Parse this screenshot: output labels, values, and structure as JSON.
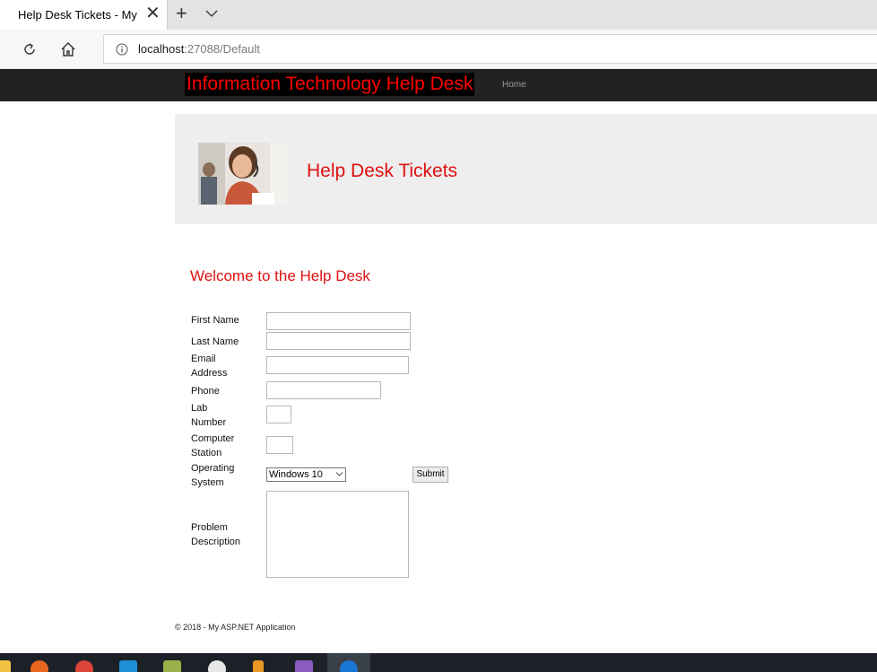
{
  "browser": {
    "tab_title": "Help Desk Tickets - My",
    "close_glyph": "✕",
    "new_tab_glyph": "+",
    "url_host": "localhost",
    "url_rest": ":27088/Default"
  },
  "site": {
    "brand": "Information Technology Help Desk",
    "nav_items": [
      "Home"
    ]
  },
  "jumbotron": {
    "title": "Help Desk Tickets"
  },
  "main": {
    "heading": "Welcome to the Help Desk"
  },
  "form": {
    "labels": {
      "first_name": "First Name",
      "last_name": "Last Name",
      "email": "Email Address",
      "phone": "Phone",
      "lab": "Lab Number",
      "computer": "Computer Station",
      "os": "Operating System",
      "problem": "Problem Description"
    },
    "values": {
      "first_name": "",
      "last_name": "",
      "email": "",
      "phone": "",
      "lab": "",
      "computer": "",
      "problem": ""
    },
    "os_selected": "Windows 10",
    "submit_label": "Submit"
  },
  "footer": {
    "text": "© 2018 - My ASP.NET Application"
  },
  "taskbar": {
    "icons": [
      "file-explorer-icon",
      "firefox-icon",
      "chrome-icon",
      "teamviewer-icon",
      "notepad-icon",
      "paint-icon",
      "office-icon",
      "visual-studio-icon",
      "edge-icon"
    ]
  },
  "colors": {
    "accent_red": "#e01010",
    "navbar": "#222222",
    "jumbotron": "#eeeeee"
  }
}
